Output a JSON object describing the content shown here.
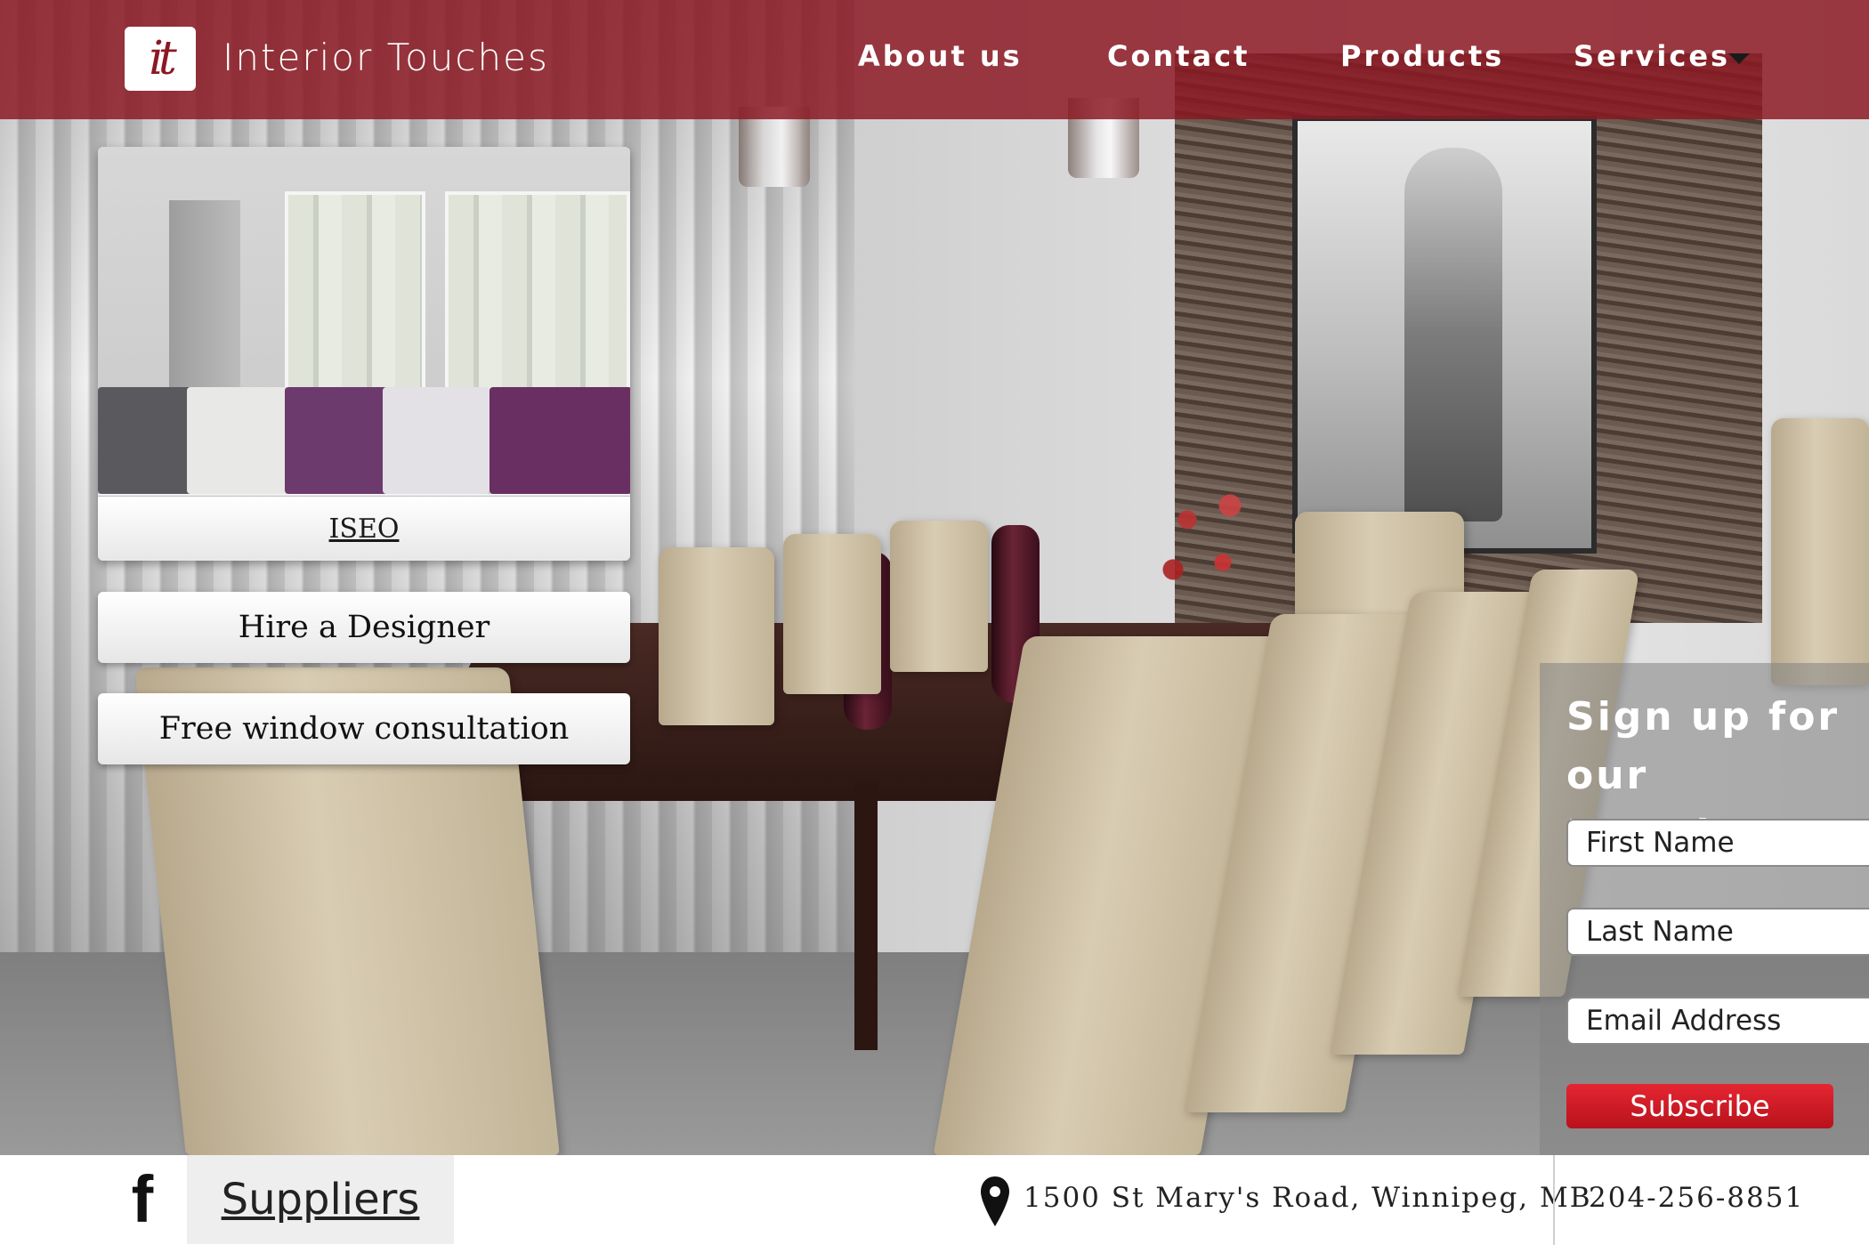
{
  "header": {
    "brand": "Interior Touches",
    "logo_text": "it",
    "nav": [
      {
        "label": "About us"
      },
      {
        "label": "Contact"
      },
      {
        "label": "Products"
      },
      {
        "label": "Services"
      }
    ]
  },
  "feature": {
    "label": "ISEO"
  },
  "cta": {
    "hire": "Hire a Designer",
    "window": "Free window consultation"
  },
  "newsletter": {
    "title": "Sign up for our Newsletter",
    "first_name_placeholder": "First Name",
    "last_name_placeholder": "Last Name",
    "email_placeholder": "Email Address",
    "submit_label": "Subscribe"
  },
  "footer": {
    "facebook_glyph": "f",
    "suppliers": "Suppliers",
    "address": "1500 St Mary's Road, Winnipeg, MB",
    "phone": "204-256-8851"
  },
  "colors": {
    "header": "#8c1822",
    "subscribe": "#d01c26"
  },
  "icons": {
    "logo": "interior-touches-logo",
    "dropdown": "caret-down-icon",
    "facebook": "facebook-icon",
    "location": "map-pin-icon"
  }
}
